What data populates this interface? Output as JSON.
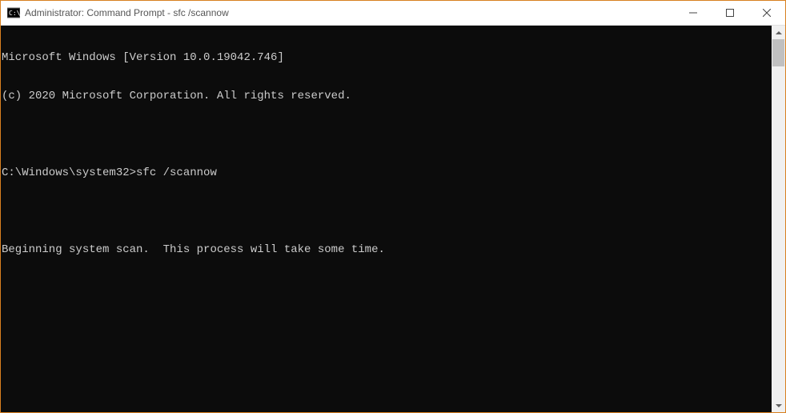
{
  "window": {
    "title": "Administrator: Command Prompt - sfc  /scannow"
  },
  "console": {
    "lines": [
      "Microsoft Windows [Version 10.0.19042.746]",
      "(c) 2020 Microsoft Corporation. All rights reserved.",
      "",
      "C:\\Windows\\system32>sfc /scannow",
      "",
      "Beginning system scan.  This process will take some time.",
      ""
    ]
  }
}
